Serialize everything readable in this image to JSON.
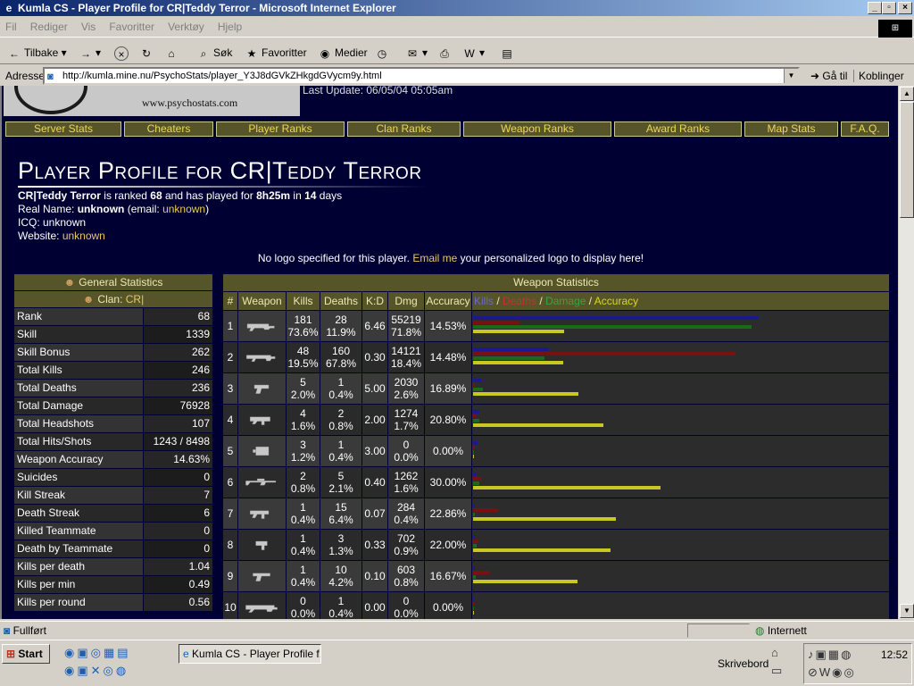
{
  "window": {
    "title": "Kumla CS - Player Profile for CR|Teddy Terror - Microsoft Internet Explorer"
  },
  "menu": [
    "Fil",
    "Rediger",
    "Vis",
    "Favoritter",
    "Verktøy",
    "Hjelp"
  ],
  "toolbar": {
    "back": "Tilbake",
    "search": "Søk",
    "favorites": "Favoritter",
    "media": "Medier"
  },
  "address": {
    "label": "Adresse",
    "url": "http://kumla.mine.nu/PsychoStats/player_Y3J8dGVkZHkgdGVycm9y.html",
    "go": "Gå til",
    "links": "Koblinger"
  },
  "page": {
    "logo_url": "www.psychostats.com",
    "last_update": "Last Update:   06/05/04 05:05am",
    "nav": [
      "Server Stats",
      "Cheaters",
      "Player Ranks",
      "Clan Ranks",
      "Weapon Ranks",
      "Award Ranks",
      "Map Stats",
      "F.A.Q."
    ],
    "title": "Player Profile for CR|Teddy Terror",
    "summary": {
      "player": "CR|Teddy Terror",
      "t1": " is ranked ",
      "rank": "68",
      "t2": " and has played for ",
      "time": "8h25m",
      "t3": " in ",
      "days": "14",
      "t4": " days"
    },
    "real_name": {
      "label": "Real Name: ",
      "value": "unknown",
      "email_label": " (email: ",
      "email": "unknown",
      "close": ")"
    },
    "icq": "ICQ: unknown",
    "website": {
      "label": "Website: ",
      "value": "unknown"
    },
    "nologo": {
      "t1": "No logo specified for this player. ",
      "link": "Email me",
      "t2": " your personalized logo to display here!"
    },
    "general": {
      "title": "General Statistics",
      "clan_label": "Clan: ",
      "clan": "CR|",
      "rows": [
        {
          "label": "Rank",
          "value": "68"
        },
        {
          "label": "Skill",
          "value": "1339"
        },
        {
          "label": "Skill Bonus",
          "value": "262"
        },
        {
          "label": "Total Kills",
          "value": "246"
        },
        {
          "label": "Total Deaths",
          "value": "236"
        },
        {
          "label": "Total Damage",
          "value": "76928"
        },
        {
          "label": "Total Headshots",
          "value": "107"
        },
        {
          "label": "Total Hits/Shots",
          "value": "1243 / 8498"
        },
        {
          "label": "Weapon Accuracy",
          "value": "14.63%"
        },
        {
          "label": "Suicides",
          "value": "0"
        },
        {
          "label": "Kill Streak",
          "value": "7"
        },
        {
          "label": "Death Streak",
          "value": "6"
        },
        {
          "label": "Killed Teammate",
          "value": "0"
        },
        {
          "label": "Death by Teammate",
          "value": "0"
        },
        {
          "label": "Kills per death",
          "value": "1.04"
        },
        {
          "label": "Kills per min",
          "value": "0.49"
        },
        {
          "label": "Kills per round",
          "value": "0.56"
        }
      ]
    },
    "weapons": {
      "title": "Weapon Statistics",
      "cols": [
        "#",
        "Weapon",
        "Kills",
        "Deaths",
        "K:D",
        "Dmg",
        "Accuracy"
      ],
      "legend": {
        "kills": "Kills",
        "deaths": "Deaths",
        "damage": "Damage",
        "accuracy": "Accuracy",
        "sep": " / "
      },
      "colors": {
        "kills": "#1a1a8c",
        "deaths": "#7a1010",
        "damage": "#1a6a1a",
        "accuracy": "#c8c820"
      },
      "rows": [
        {
          "n": "1",
          "icon": "ak47-icon",
          "kills": "181",
          "kpct": "73.6%",
          "deaths": "28",
          "dpct": "11.9%",
          "kd": "6.46",
          "dmg": "55219",
          "dmgpct": "71.8%",
          "acc": "14.53%",
          "bars": {
            "kills": 73.6,
            "deaths": 11.9,
            "damage": 71.8,
            "accuracy": 14.53
          }
        },
        {
          "n": "2",
          "icon": "m4a1-icon",
          "kills": "48",
          "kpct": "19.5%",
          "deaths": "160",
          "dpct": "67.8%",
          "kd": "0.30",
          "dmg": "14121",
          "dmgpct": "18.4%",
          "acc": "14.48%",
          "bars": {
            "kills": 19.5,
            "deaths": 67.8,
            "damage": 18.4,
            "accuracy": 14.48
          }
        },
        {
          "n": "3",
          "icon": "pistol-icon",
          "kills": "5",
          "kpct": "2.0%",
          "deaths": "1",
          "dpct": "0.4%",
          "kd": "5.00",
          "dmg": "2030",
          "dmgpct": "2.6%",
          "acc": "16.89%",
          "bars": {
            "kills": 2.0,
            "deaths": 0.4,
            "damage": 2.6,
            "accuracy": 16.89
          }
        },
        {
          "n": "4",
          "icon": "smg-icon",
          "kills": "4",
          "kpct": "1.6%",
          "deaths": "2",
          "dpct": "0.8%",
          "kd": "2.00",
          "dmg": "1274",
          "dmgpct": "1.7%",
          "acc": "20.80%",
          "bars": {
            "kills": 1.6,
            "deaths": 0.8,
            "damage": 1.7,
            "accuracy": 20.8
          }
        },
        {
          "n": "5",
          "icon": "grenade-icon",
          "kills": "3",
          "kpct": "1.2%",
          "deaths": "1",
          "dpct": "0.4%",
          "kd": "3.00",
          "dmg": "0",
          "dmgpct": "0.0%",
          "acc": "0.00%",
          "bars": {
            "kills": 1.2,
            "deaths": 0.4,
            "damage": 0,
            "accuracy": 0
          }
        },
        {
          "n": "6",
          "icon": "sniper-icon",
          "kills": "2",
          "kpct": "0.8%",
          "deaths": "5",
          "dpct": "2.1%",
          "kd": "0.40",
          "dmg": "1262",
          "dmgpct": "1.6%",
          "acc": "30.00%",
          "bars": {
            "kills": 0.8,
            "deaths": 2.1,
            "damage": 1.6,
            "accuracy": 30
          }
        },
        {
          "n": "7",
          "icon": "mp5-icon",
          "kills": "1",
          "kpct": "0.4%",
          "deaths": "15",
          "dpct": "6.4%",
          "kd": "0.07",
          "dmg": "284",
          "dmgpct": "0.4%",
          "acc": "22.86%",
          "bars": {
            "kills": 0.4,
            "deaths": 6.4,
            "damage": 0.4,
            "accuracy": 22.86
          }
        },
        {
          "n": "8",
          "icon": "mac10-icon",
          "kills": "1",
          "kpct": "0.4%",
          "deaths": "3",
          "dpct": "1.3%",
          "kd": "0.33",
          "dmg": "702",
          "dmgpct": "0.9%",
          "acc": "22.00%",
          "bars": {
            "kills": 0.4,
            "deaths": 1.3,
            "damage": 0.9,
            "accuracy": 22
          }
        },
        {
          "n": "9",
          "icon": "deagle-icon",
          "kills": "1",
          "kpct": "0.4%",
          "deaths": "10",
          "dpct": "4.2%",
          "kd": "0.10",
          "dmg": "603",
          "dmgpct": "0.8%",
          "acc": "16.67%",
          "bars": {
            "kills": 0.4,
            "deaths": 4.2,
            "damage": 0.8,
            "accuracy": 16.67
          }
        },
        {
          "n": "10",
          "icon": "rifle-icon",
          "kills": "0",
          "kpct": "0.0%",
          "deaths": "1",
          "dpct": "0.4%",
          "kd": "0.00",
          "dmg": "0",
          "dmgpct": "0.0%",
          "acc": "0.00%",
          "bars": {
            "kills": 0,
            "deaths": 0.4,
            "damage": 0,
            "accuracy": 0
          }
        }
      ]
    }
  },
  "status": {
    "text": "Fullført",
    "zone": "Internett"
  },
  "taskbar": {
    "start": "Start",
    "task": "Kumla CS - Player Profile f...",
    "desktop": "Skrivebord",
    "clock": "12:52"
  }
}
